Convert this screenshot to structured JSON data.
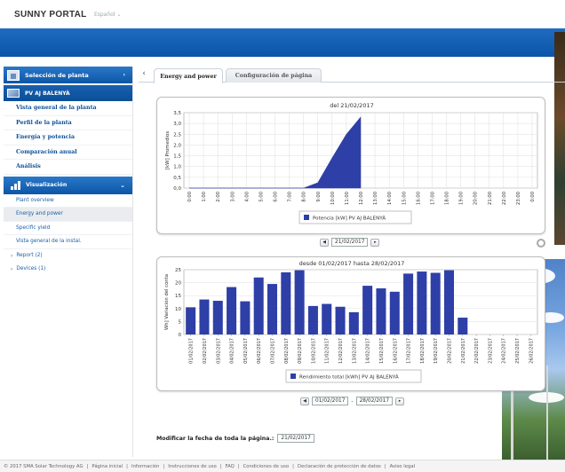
{
  "header": {
    "logo": "SUNNY PORTAL",
    "language": "Español"
  },
  "sidebar": {
    "plant_select": "Selección de planta",
    "plant_name": "PV AJ BALENYÀ",
    "links": [
      "Vista general de la planta",
      "Perfil de la planta",
      "Energía y potencia",
      "Comparación anual",
      "Análisis"
    ],
    "visualization": "Visualización",
    "sub_links": [
      "Plant overview",
      "Energy and power",
      "Specific yield",
      "Vista general de la instal."
    ],
    "tree": [
      "Report (2)",
      "Devices (1)"
    ]
  },
  "tabs": [
    {
      "label": "Energy and power",
      "active": true
    },
    {
      "label": "Configuración de página",
      "active": false
    }
  ],
  "chart_data": [
    {
      "type": "area",
      "title": "del 21/02/2017",
      "ylabel": "[kW] Promedios",
      "ylim": [
        0,
        3.5
      ],
      "yticks": [
        "0,0",
        "0,5",
        "1,0",
        "1,5",
        "2,0",
        "2,5",
        "3,0",
        "3,5"
      ],
      "x": [
        "0:00",
        "1:00",
        "2:00",
        "3:00",
        "4:00",
        "5:00",
        "6:00",
        "7:00",
        "8:00",
        "9:00",
        "10:00",
        "11:00",
        "12:00",
        "13:00",
        "14:00",
        "15:00",
        "16:00",
        "17:00",
        "18:00",
        "19:00",
        "20:00",
        "21:00",
        "22:00",
        "23:00",
        "0:00"
      ],
      "series": [
        {
          "name": "Potencia [kW] PV AJ BALENYÀ",
          "values": [
            0,
            0,
            0,
            0,
            0,
            0,
            0,
            0,
            0,
            0.25,
            1.4,
            2.5,
            3.3,
            null,
            null,
            null,
            null,
            null,
            null,
            null,
            null,
            null,
            null,
            null,
            null
          ]
        }
      ],
      "color": "#2e3fa8",
      "grid": true,
      "legend": "bottom"
    },
    {
      "type": "bar",
      "title": "desde 01/02/2017 hasta 28/02/2017",
      "ylabel": "Wh] Variación del conta",
      "ylim": [
        0,
        25
      ],
      "yticks": [
        "0",
        "5",
        "10",
        "15",
        "20",
        "25"
      ],
      "categories": [
        "01/02/2017",
        "02/02/2017",
        "03/02/2017",
        "04/02/2017",
        "05/02/2017",
        "06/02/2017",
        "07/02/2017",
        "08/02/2017",
        "09/02/2017",
        "10/02/2017",
        "11/02/2017",
        "12/02/2017",
        "13/02/2017",
        "14/02/2017",
        "15/02/2017",
        "16/02/2017",
        "17/02/2017",
        "18/02/2017",
        "19/02/2017",
        "20/02/2017",
        "21/02/2017",
        "22/02/2017",
        "23/02/2017",
        "24/02/2017",
        "25/02/2017",
        "26/02/2017"
      ],
      "series": [
        {
          "name": "Rendimiento total [kWh] PV AJ BALENYÀ",
          "values": [
            10.5,
            13.5,
            13,
            18.3,
            12.8,
            22,
            19.5,
            24,
            24.8,
            11,
            11.8,
            10.7,
            8.6,
            18.8,
            17.8,
            16.5,
            23.5,
            24.3,
            23.8,
            24.8,
            6.5,
            0,
            0,
            0,
            0,
            0
          ]
        }
      ],
      "color": "#2e3fa8",
      "grid": true,
      "legend": "bottom"
    }
  ],
  "date_nav_1": {
    "date": "21/02/2017"
  },
  "date_nav_2": {
    "from": "01/02/2017",
    "separator": "-",
    "to": "28/02/2017"
  },
  "modify_date": {
    "label": "Modificar la fecha de toda la página.:",
    "value": "21/02/2017"
  },
  "footer": [
    "© 2017 SMA Solar Technology AG",
    "|",
    "Página inicial",
    "|",
    "Información",
    "|",
    "Instrucciones de uso",
    "|",
    "FAQ",
    "|",
    "Condiciones de uso",
    "|",
    "Declaración de protección de datos",
    "|",
    "Aviso legal"
  ]
}
